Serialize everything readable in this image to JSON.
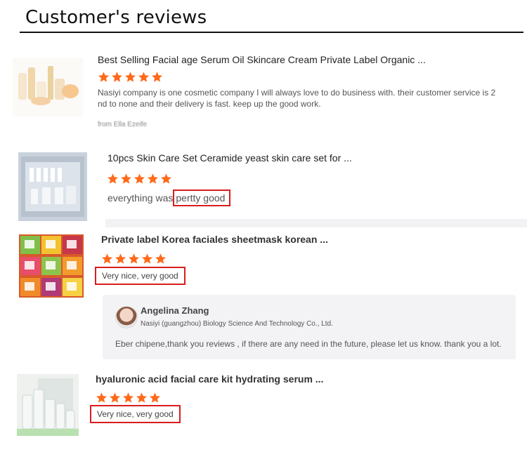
{
  "header": {
    "title": "Customer's reviews"
  },
  "colors": {
    "star": "#ff6a1a",
    "highlight_border": "#d81e1e",
    "reply_bg": "#f3f3f5"
  },
  "reviews": [
    {
      "product_title": "Best Selling Facial age Serum Oil Skincare Cream Private Label Organic ...",
      "rating": 5,
      "comment_line1": "Nasiyi company is one cosmetic company I will always love to do business with. their customer service is 2",
      "comment_line2": "nd to none and their delivery is fast. keep up the good work.",
      "from": "from Ella Ezeife"
    },
    {
      "product_title": "10pcs Skin Care Set Ceramide yeast skin care set for ...",
      "rating": 5,
      "comment_prefix": "everything was",
      "comment_highlight": "pertty good"
    },
    {
      "product_title": "Private label Korea faciales sheetmask korean ...",
      "rating": 5,
      "comment": "Very nice, very good",
      "reply": {
        "name": "Angelina Zhang",
        "company": "Nasiyi (guangzhou) Biology Science And Technology Co., Ltd.",
        "text": "Eber chipene,thank you reviews , if there are any need in the future, please let us know. thank you a lot."
      }
    },
    {
      "product_title": "hyaluronic acid facial care kit hydrating serum ...",
      "rating": 5,
      "comment": "Very nice, very good"
    }
  ]
}
